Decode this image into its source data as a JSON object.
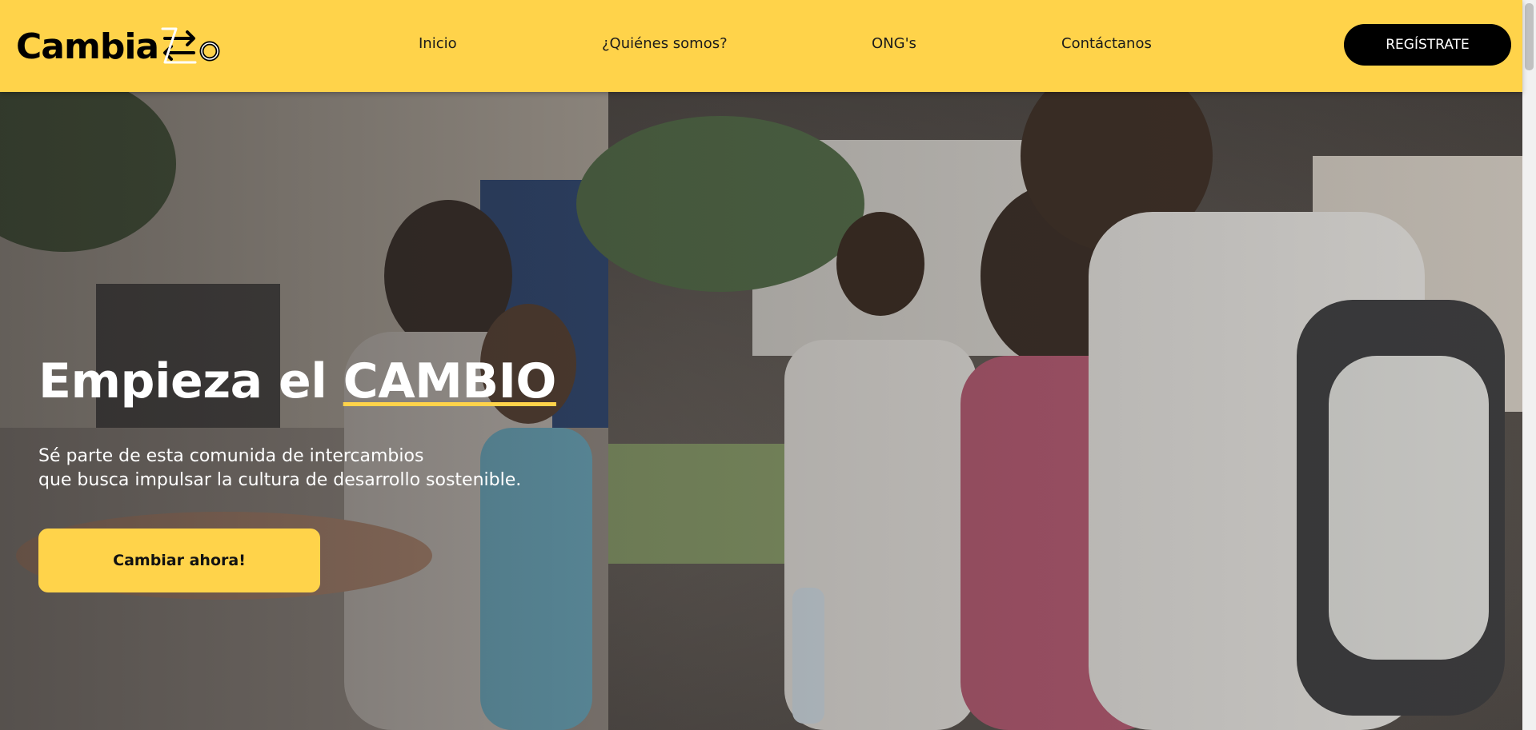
{
  "brand": {
    "name": "Cambia",
    "logo_icon": "exchange-arrows-icon",
    "accent_color": "#ffd34a"
  },
  "nav": {
    "links": [
      "Inicio",
      "¿Quiénes somos?",
      "ONG's",
      "Contáctanos"
    ],
    "register_label": "REGÍSTRATE"
  },
  "hero": {
    "title_prefix": "Empieza el",
    "title_accent": "CAMBIO",
    "subtitle_line1": "Sé parte de esta comunida de intercambios",
    "subtitle_line2": "que busca impulsar la cultura de desarrollo sostenible.",
    "cta_label": "Cambiar ahora!",
    "image": "students-exchanging-items-photo"
  }
}
